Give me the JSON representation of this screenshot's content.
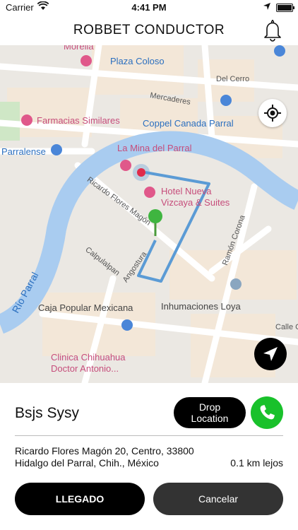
{
  "status_bar": {
    "carrier": "Carrier",
    "time": "4:41 PM"
  },
  "header": {
    "title": "ROBBET CONDUCTOR",
    "bell_icon": "bell-icon"
  },
  "map": {
    "labels": {
      "plaza_coloso": "Plaza Coloso",
      "morelia": "Morelia",
      "del_cerro": "Del Cerro",
      "mercaderes": "Mercaderes",
      "farmacias": "Farmacias Similares",
      "coppel": "Coppel Canada Parral",
      "parralense": "Parralense",
      "la_mina": "La Mina del Parral",
      "hotel_line1": "Hotel Nueva",
      "hotel_line2": "Vizcaya & Suites",
      "ricardo_flores": "Ricardo Flores Magón",
      "ramon_corona": "Ramón Corona",
      "calpulalpan": "Calpulalpan",
      "angostura": "Angostura",
      "rio_parral": "Río Parral",
      "caja_popular": "Caja Popular Mexicana",
      "inhumaciones": "Inhumaciones Loya",
      "calle_c": "Calle C",
      "clinica_line1": "Clinica Chihuahua",
      "clinica_line2": "Doctor Antonio..."
    },
    "route_color": "#5b9bd5",
    "river_color": "#aacdf0"
  },
  "trip": {
    "passenger_name": "Bsjs Sysy",
    "drop_button_line1": "Drop",
    "drop_button_line2": "Location",
    "address_line1": "Ricardo Flores Magón 20, Centro, 33800",
    "address_line2": "Hidalgo del Parral, Chih., México",
    "distance": "0.1 km lejos"
  },
  "actions": {
    "arrived_label": "LLEGADO",
    "cancel_label": "Cancelar"
  },
  "colors": {
    "call_green": "#19c12b",
    "primary_black": "#000000"
  }
}
